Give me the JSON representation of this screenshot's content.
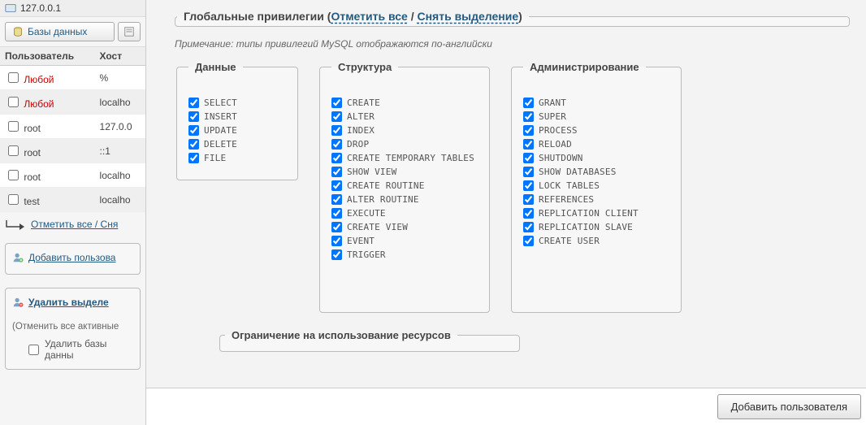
{
  "server": {
    "host": "127.0.0.1"
  },
  "sidebar": {
    "databases_btn": "Базы данных",
    "col_user": "Пользователь",
    "col_host": "Хост",
    "users": [
      {
        "name": "Любой",
        "host": "%",
        "anyuser": true
      },
      {
        "name": "Любой",
        "host": "localho",
        "anyuser": true
      },
      {
        "name": "root",
        "host": "127.0.0",
        "anyuser": false
      },
      {
        "name": "root",
        "host": "::1",
        "anyuser": false
      },
      {
        "name": "root",
        "host": "localho",
        "anyuser": false
      },
      {
        "name": "test",
        "host": "localho",
        "anyuser": false
      }
    ],
    "check_all": "Отметить все / Сня",
    "add_user": "Добавить пользова",
    "delete_selected": "Удалить выделе",
    "revoke_note": "(Отменить все активные",
    "delete_db_label": "Удалить базы данны"
  },
  "global": {
    "title": "Глобальные привилегии",
    "check_all": "Отметить все",
    "uncheck_all": "Снять выделение",
    "note": "Примечание: типы привилегий MySQL отображаются по-английски"
  },
  "privileges": {
    "data": {
      "legend": "Данные",
      "items": [
        "SELECT",
        "INSERT",
        "UPDATE",
        "DELETE",
        "FILE"
      ]
    },
    "structure": {
      "legend": "Структура",
      "items": [
        "CREATE",
        "ALTER",
        "INDEX",
        "DROP",
        "CREATE TEMPORARY TABLES",
        "SHOW VIEW",
        "CREATE ROUTINE",
        "ALTER ROUTINE",
        "EXECUTE",
        "CREATE VIEW",
        "EVENT",
        "TRIGGER"
      ]
    },
    "admin": {
      "legend": "Администрирование",
      "items": [
        "GRANT",
        "SUPER",
        "PROCESS",
        "RELOAD",
        "SHUTDOWN",
        "SHOW DATABASES",
        "LOCK TABLES",
        "REFERENCES",
        "REPLICATION CLIENT",
        "REPLICATION SLAVE",
        "CREATE USER"
      ]
    }
  },
  "limits": {
    "legend": "Ограничение на использование ресурсов"
  },
  "footer": {
    "add_user": "Добавить пользователя"
  }
}
